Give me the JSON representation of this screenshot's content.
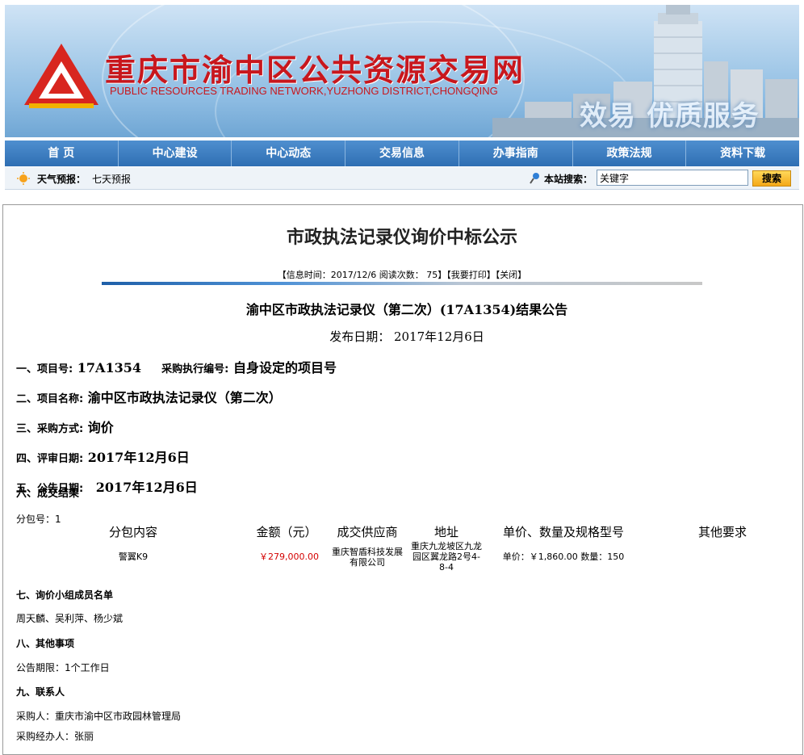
{
  "header": {
    "site_title": "重庆市渝中区公共资源交易网",
    "site_subtitle": "PUBLIC RESOURCES TRADING NETWORK,YUZHONG DISTRICT,CHONGQING",
    "slogan": "效易 优质服务"
  },
  "nav": {
    "items": [
      {
        "label": "首 页"
      },
      {
        "label": "中心建设"
      },
      {
        "label": "中心动态"
      },
      {
        "label": "交易信息"
      },
      {
        "label": "办事指南"
      },
      {
        "label": "政策法规"
      },
      {
        "label": "资料下载"
      }
    ]
  },
  "subbar": {
    "weather_label": "天气预报：",
    "weather_link": "七天预报",
    "search_label": "本站搜索：",
    "search_value": "关键字",
    "search_button": "搜索"
  },
  "article": {
    "title": "市政执法记录仪询价中标公示",
    "info_line": "【信息时间：2017/12/6 阅读次数： 75】【我要打印】【关闭】",
    "announcement_title": "渝中区市政执法记录仪（第二次）(17A1354)结果公告",
    "publish_date": "发布日期： 2017年12月6日",
    "item1_label": "一、项目号:",
    "item1_value": "17A1354",
    "item1_label2": "采购执行编号:",
    "item1_value2": "自身设定的项目号",
    "item2_label": "二、项目名称:",
    "item2_value": "渝中区市政执法记录仪（第二次）",
    "item3_label": "三、采购方式:",
    "item3_value": "询价",
    "item4_label": "四、评审日期:",
    "item4_value": "2017年12月6日",
    "item5_label": "五、公告日期:",
    "item6_label": "六、成交结果",
    "item5_value": "2017年12月6日",
    "package_no": "分包号：1",
    "table": {
      "headers": [
        "分包内容",
        "金额（元）",
        "成交供应商",
        "地址",
        "单价、数量及规格型号",
        "其他要求"
      ],
      "row": {
        "content": "警翼K9",
        "amount": "￥279,000.00",
        "supplier": "重庆智盾科技发展有限公司",
        "address": "重庆九龙坡区九龙园区翼龙路2号4-8-4",
        "spec": "单价：￥1,860.00 数量：150",
        "other": ""
      }
    },
    "section7_title": "七、询价小组成员名单",
    "section7_text": "周天麟、吴利萍、杨少斌",
    "section8_title": "八、其他事项",
    "section8_text": "公告期限：1个工作日",
    "section9_title": "九、联系人",
    "contact1": "采购人：重庆市渝中区市政园林管理局",
    "contact2": "采购经办人：张丽"
  },
  "colors": {
    "brand_red": "#c8171d",
    "nav_blue": "#2f6fb3",
    "amount_red": "#d40000"
  }
}
